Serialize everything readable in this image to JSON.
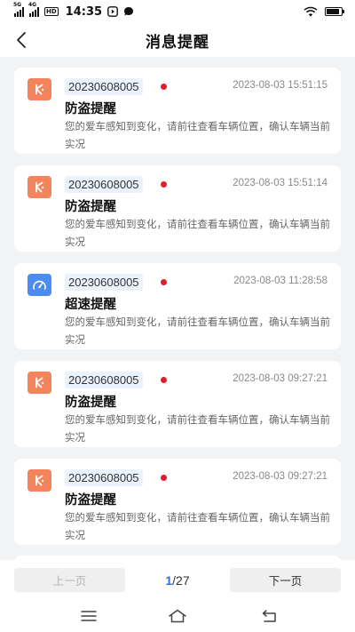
{
  "status_bar": {
    "signal1_label": "5G",
    "signal2_label": "4G",
    "hd_label": "HD",
    "time": "14:35",
    "battery_level": 0.9
  },
  "header": {
    "title": "消息提醒"
  },
  "messages": [
    {
      "type": "theft",
      "icon": "theft-alert-icon",
      "device_id": "20230608005",
      "timestamp": "2023-08-03 15:51:15",
      "title": "防盗提醒",
      "content": "您的爱车感知到变化，请前往查看车辆位置，确认车辆当前实况",
      "unread": true
    },
    {
      "type": "theft",
      "icon": "theft-alert-icon",
      "device_id": "20230608005",
      "timestamp": "2023-08-03 15:51:14",
      "title": "防盗提醒",
      "content": "您的爱车感知到变化，请前往查看车辆位置，确认车辆当前实况",
      "unread": true
    },
    {
      "type": "speed",
      "icon": "speedometer-icon",
      "device_id": "20230608005",
      "timestamp": "2023-08-03 11:28:58",
      "title": "超速提醒",
      "content": "您的爱车感知到变化，请前往查看车辆位置，确认车辆当前实况",
      "unread": true
    },
    {
      "type": "theft",
      "icon": "theft-alert-icon",
      "device_id": "20230608005",
      "timestamp": "2023-08-03 09:27:21",
      "title": "防盗提醒",
      "content": "您的爱车感知到变化，请前往查看车辆位置，确认车辆当前实况",
      "unread": true
    },
    {
      "type": "theft",
      "icon": "theft-alert-icon",
      "device_id": "20230608005",
      "timestamp": "2023-08-03 09:27:21",
      "title": "防盗提醒",
      "content": "您的爱车感知到变化，请前往查看车辆位置，确认车辆当前实况",
      "unread": true
    }
  ],
  "pagination": {
    "prev_label": "上一页",
    "next_label": "下一页",
    "current_page": "1",
    "total_pages": "/27"
  },
  "colors": {
    "theft_icon_bg": "#f4845b",
    "speed_icon_bg": "#4b8cf2",
    "device_tag_bg": "#eaf2fd",
    "unread_dot": "#e01e2b",
    "page_accent": "#2e6ed8"
  },
  "system_nav": {
    "buttons": [
      "menu-icon",
      "home-icon",
      "back-icon"
    ]
  }
}
